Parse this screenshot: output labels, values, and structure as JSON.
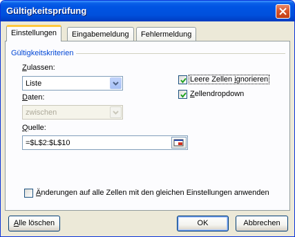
{
  "window": {
    "title": "Gültigkeitsprüfung"
  },
  "tabs": [
    {
      "label": "Einstellungen",
      "active": true
    },
    {
      "label": "Eingabemeldung",
      "active": false
    },
    {
      "label": "Fehlermeldung",
      "active": false
    }
  ],
  "criteria": {
    "group_label": "Gültigkeitskriterien",
    "allow_label_mnemonic": "Z",
    "allow_label_rest": "ulassen:",
    "allow_value": "Liste",
    "data_label_mnemonic": "D",
    "data_label_rest": "aten:",
    "data_value": "zwischen",
    "source_label_mnemonic": "Q",
    "source_label_rest": "uelle:",
    "source_value": "=$L$2:$L$10",
    "ignore_blank_pre": "Leere Zellen ",
    "ignore_blank_mnemonic": "i",
    "ignore_blank_post": "gnorieren",
    "ignore_blank_checked": true,
    "dropdown_mnemonic": "Z",
    "dropdown_rest": "ellendropdown",
    "dropdown_checked": true,
    "apply_all_mnemonic": "Ä",
    "apply_all_rest": "nderungen auf alle Zellen mit den gleichen Einstellungen anwenden",
    "apply_all_checked": false
  },
  "buttons": {
    "clear_all_mnemonic": "A",
    "clear_all_rest": "lle löschen",
    "ok": "OK",
    "cancel": "Abbrechen"
  },
  "colors": {
    "title_bar": "#0054e3",
    "group_label": "#0046d5",
    "tab_highlight": "#ffc83c",
    "checkmark": "#21a121"
  }
}
